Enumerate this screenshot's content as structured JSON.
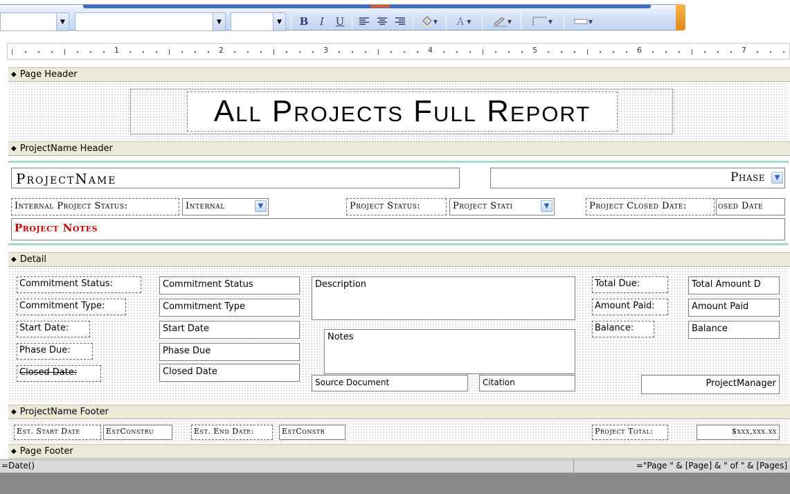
{
  "toolbar": {
    "font_name_value": "",
    "font_size_value": "",
    "bold_label": "B",
    "italic_label": "I",
    "underline_label": "U",
    "font_color_label": "A"
  },
  "ruler": {
    "numbers": [
      "1",
      "2",
      "3",
      "4",
      "5",
      "6",
      "7"
    ]
  },
  "bands": {
    "page_header": "Page Header",
    "projectname_header": "ProjectName Header",
    "detail": "Detail",
    "projectname_footer": "ProjectName Footer",
    "page_footer": "Page Footer"
  },
  "page_header": {
    "report_title": "All Projects Full Report"
  },
  "projectname_header": {
    "project_name": "ProjectName",
    "phase": "Phase",
    "internal_status_label": "Internal Project Status:",
    "internal_status_value": "Internal",
    "project_status_label": "Project Status:",
    "project_status_value": "Project Stati",
    "closed_date_label": "Project Closed Date:",
    "closed_date_value": "osed Date",
    "project_notes": "Project Notes"
  },
  "detail": {
    "commitment_status_label": "Commitment Status:",
    "commitment_status_value": "Commitment Status",
    "commitment_type_label": "Commitment Type:",
    "commitment_type_value": "Commitment Type",
    "start_date_label": "Start Date:",
    "start_date_value": "Start Date",
    "phase_due_label": "Phase Due:",
    "phase_due_value": "Phase Due",
    "closed_date_label": "Closed Date:",
    "closed_date_value": "Closed Date",
    "description": "Description",
    "notes": "Notes",
    "source_document": "Source Document",
    "citation": "Citation",
    "total_due_label": "Total Due:",
    "total_due_value": "Total Amount D",
    "amount_paid_label": "Amount Paid:",
    "amount_paid_value": "Amount Paid",
    "balance_label": "Balance:",
    "balance_value": "Balance",
    "project_manager": "ProjectManager"
  },
  "projectname_footer": {
    "est_start_label": "Est. Start Date",
    "est_start_value": "EstConstru",
    "est_end_label": "Est. End Date:",
    "est_end_value": "EstConstr",
    "project_total_label": "Project Total:",
    "project_total_value": "$xxx,xxx.xx"
  },
  "page_footer": {
    "date_expr": "=Date()",
    "page_expr": "=\"Page \" & [Page] & \" of \" & [Pages]"
  },
  "colors": {
    "project_notes": "#cc0000",
    "header_rule": "#a8d8c8"
  }
}
